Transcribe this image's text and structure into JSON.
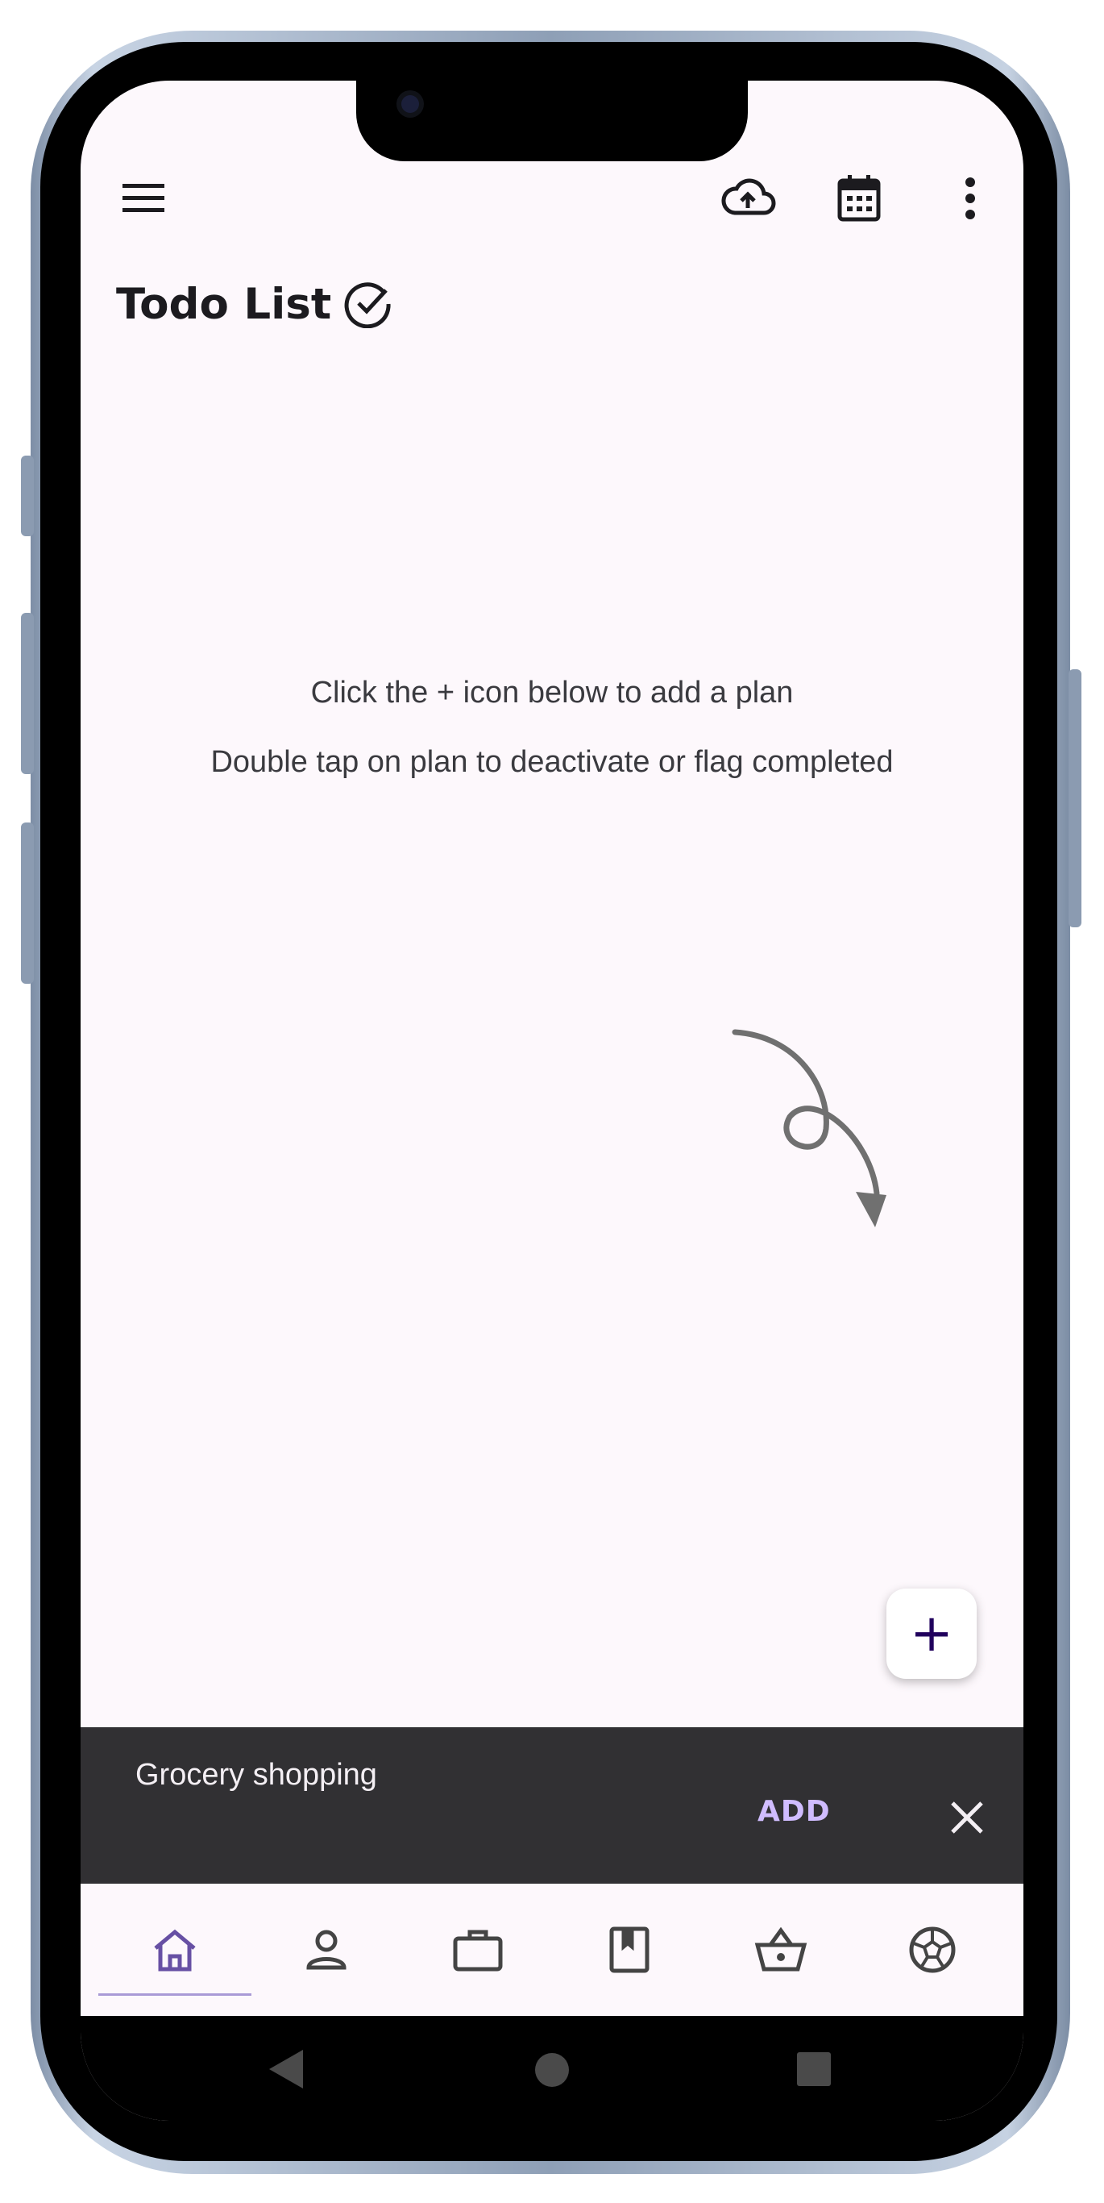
{
  "app_bar": {
    "menu_icon": "menu-icon",
    "cloud_icon": "cloud-upload-icon",
    "calendar_icon": "calendar-icon",
    "more_icon": "more-vert-icon"
  },
  "page": {
    "title": "Todo List",
    "title_icon": "check-circle-icon"
  },
  "empty_state": {
    "line1": "Click the + icon below to add a plan",
    "line2": "Double tap on plan to deactivate or flag completed"
  },
  "fab": {
    "label": "+",
    "icon": "add-icon"
  },
  "snackbar": {
    "text": "Grocery shopping",
    "action": "ADD",
    "close_icon": "close-icon"
  },
  "bottom_nav": {
    "items": [
      {
        "icon": "home-icon",
        "selected": true
      },
      {
        "icon": "person-icon",
        "selected": false
      },
      {
        "icon": "briefcase-icon",
        "selected": false
      },
      {
        "icon": "book-icon",
        "selected": false
      },
      {
        "icon": "basket-icon",
        "selected": false
      },
      {
        "icon": "soccer-ball-icon",
        "selected": false
      }
    ]
  },
  "system_nav": {
    "back_icon": "back-triangle-icon",
    "home_icon": "home-circle-icon",
    "recents_icon": "recents-square-icon"
  },
  "colors": {
    "background": "#fdf8fc",
    "snackbar": "#313033",
    "snackbar_action": "#d0bcff",
    "selected_nav": "#6750a4"
  }
}
